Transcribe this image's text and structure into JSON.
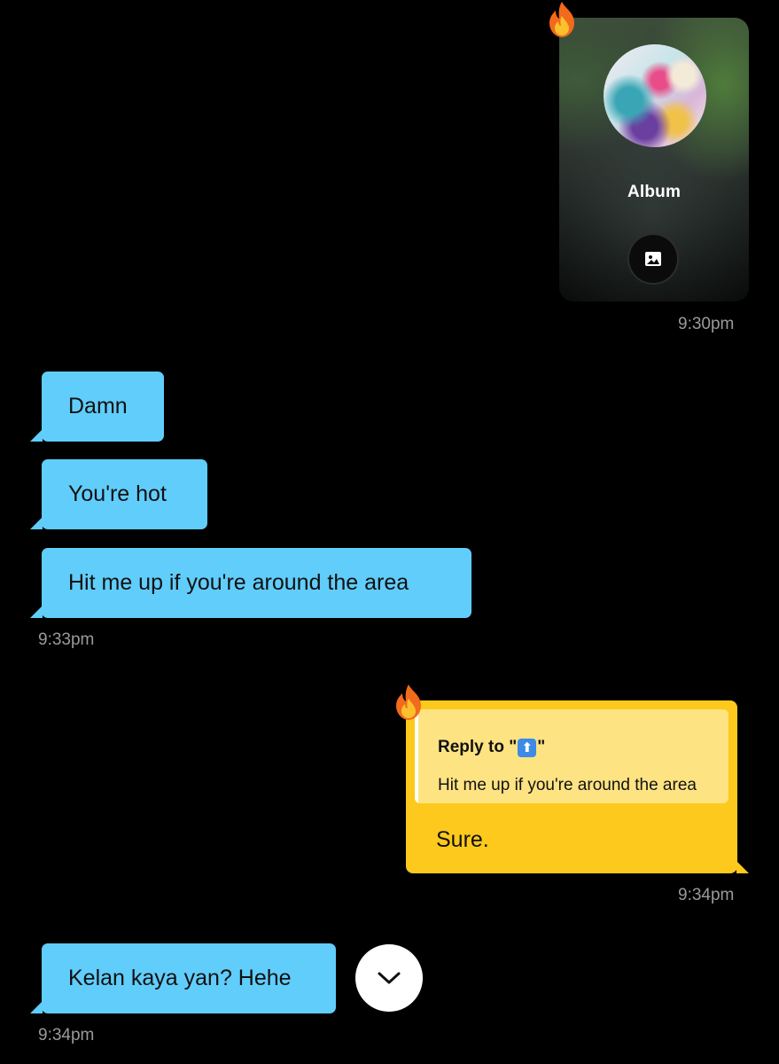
{
  "album_message": {
    "label": "Album",
    "open_icon": "image-icon",
    "badge_icon": "fire-emoji-icon",
    "timestamp": "9:30pm"
  },
  "incoming_group_1": {
    "messages": [
      "Damn",
      "You're hot",
      "Hit me up if you're around the area"
    ],
    "timestamp": "9:33pm"
  },
  "reply_message": {
    "reply_prefix": "Reply to \"",
    "reply_emoji": "⬆",
    "reply_suffix": "\"",
    "quoted_text": "Hit me up if you're around the area",
    "body": "Sure.",
    "badge_icon": "fire-emoji-icon",
    "timestamp": "9:34pm"
  },
  "incoming_group_2": {
    "messages": [
      "Kelan kaya yan? Hehe"
    ],
    "timestamp": "9:34pm"
  },
  "scroll_down_button": {
    "icon": "chevron-down-icon"
  },
  "colors": {
    "background": "#000000",
    "incoming_bubble": "#61cdfb",
    "outgoing_bubble": "#fdc91c",
    "quote_background": "#fde382",
    "timestamp_text": "#9a9a9a"
  }
}
